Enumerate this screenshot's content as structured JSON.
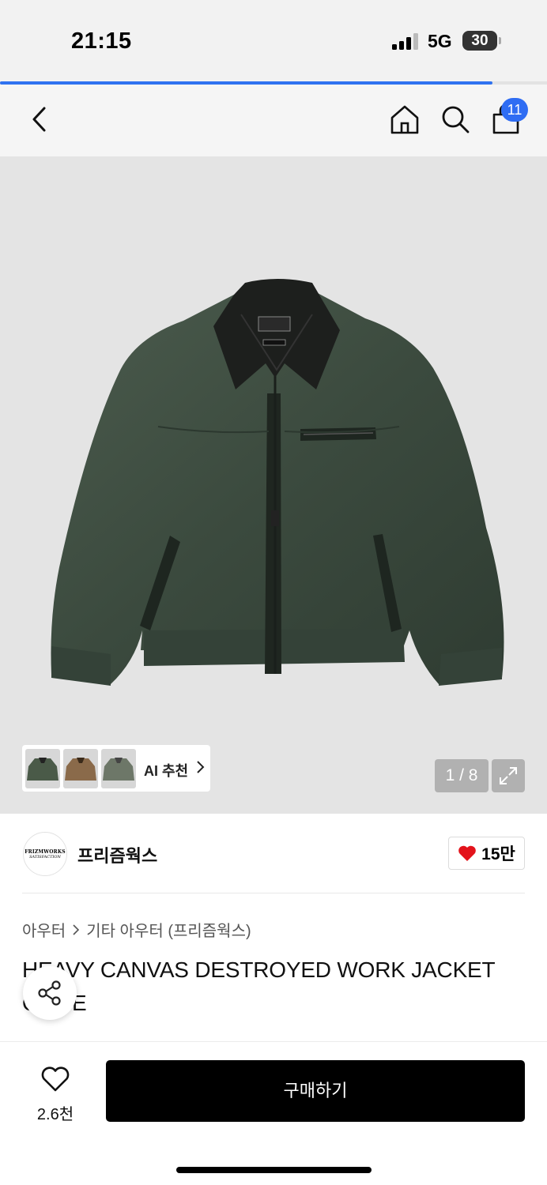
{
  "status_bar": {
    "time": "21:15",
    "network": "5G",
    "battery": "30"
  },
  "load_progress": 0.9,
  "nav": {
    "cart_count": "11",
    "icons": [
      "back-arrow-icon",
      "home-icon",
      "search-icon",
      "shopping-bag-icon"
    ]
  },
  "gallery": {
    "ai_label": "AI 추천",
    "pager": "1 / 8",
    "jacket_color": "#3b4a3e"
  },
  "brand": {
    "logo_line1": "FRIZMWORKS",
    "logo_line2": "SATISFACTION",
    "name": "프리즘웍스",
    "likes": "15만"
  },
  "breadcrumb": {
    "level1": "아우터",
    "level2": "기타 아우터 (프리즘웍스)"
  },
  "product": {
    "title": "HEAVY CANVAS DESTROYED WORK JACKET OLIVE"
  },
  "bottom": {
    "wish_count": "2.6천",
    "buy_label": "구매하기"
  },
  "colors": {
    "accent": "#2f6df3",
    "heart": "#e3131b",
    "buy": "#000000"
  }
}
